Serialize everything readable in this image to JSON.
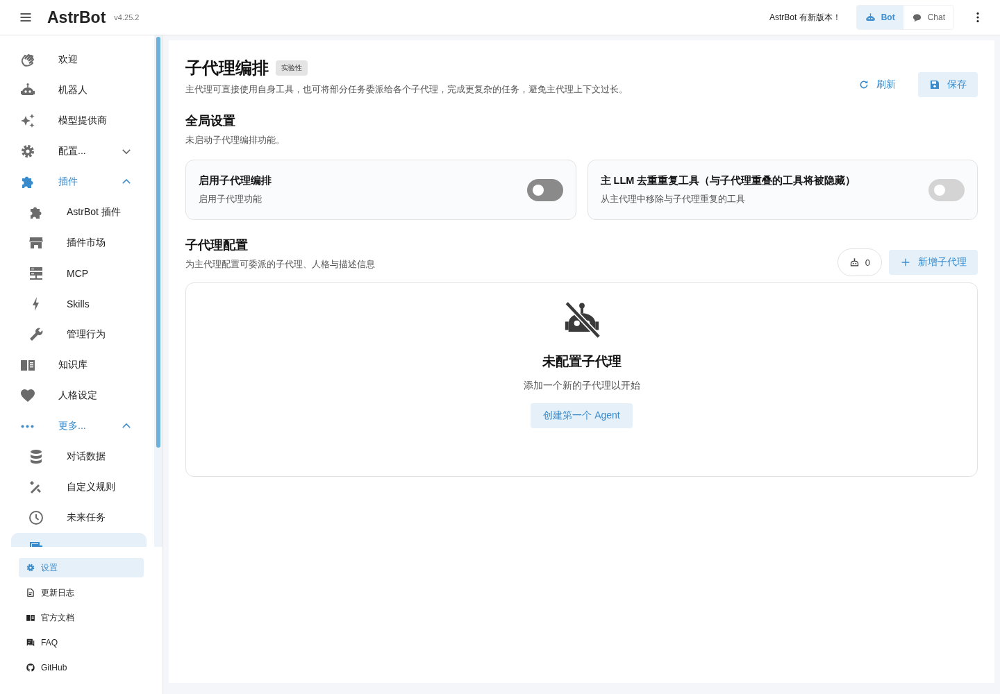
{
  "header": {
    "logo": "AstrBot",
    "version": "v4.25.2",
    "update_notice": "AstrBot 有新版本！",
    "mode_toggle": [
      {
        "label": "Bot",
        "selected": true
      },
      {
        "label": "Chat",
        "selected": false
      }
    ]
  },
  "sidebar": {
    "items": [
      {
        "label": "欢迎",
        "selected": false
      },
      {
        "label": "机器人",
        "selected": false
      },
      {
        "label": "模型提供商",
        "selected": false
      },
      {
        "label": "配置...",
        "selected": false,
        "expanded": false
      },
      {
        "label": "插件",
        "selected": false,
        "expanded": true,
        "children": [
          {
            "label": "AstrBot 插件",
            "selected": false
          },
          {
            "label": "插件市场",
            "selected": false
          },
          {
            "label": "MCP",
            "selected": false
          },
          {
            "label": "Skills",
            "selected": false
          },
          {
            "label": "管理行为",
            "selected": false
          }
        ]
      },
      {
        "label": "知识库",
        "selected": false
      },
      {
        "label": "人格设定",
        "selected": false
      },
      {
        "label": "更多...",
        "selected": false,
        "expanded": true,
        "children": [
          {
            "label": "对话数据",
            "selected": false
          },
          {
            "label": "自定义规则",
            "selected": false
          },
          {
            "label": "未来任务",
            "selected": false
          },
          {
            "selected": true
          }
        ]
      }
    ],
    "footer_items": [
      {
        "label": "设置",
        "selected": true
      },
      {
        "label": "更新日志",
        "selected": false
      },
      {
        "label": "官方文档",
        "selected": false
      },
      {
        "label": "FAQ",
        "selected": false
      },
      {
        "label": "GitHub",
        "selected": false
      }
    ]
  },
  "page": {
    "title": "子代理编排",
    "badge": "实验性",
    "description": "主代理可直接使用自身工具，也可将部分任务委派给各个子代理，完成更复杂的任务，避免主代理上下文过长。",
    "actions": {
      "refresh": "刷新",
      "save": "保存"
    }
  },
  "global_settings": {
    "heading": "全局设置",
    "note": "未启动子代理编排功能。",
    "toggles": [
      {
        "title": "启用子代理编排",
        "subtitle": "启用子代理功能",
        "on": false,
        "disabled": false
      },
      {
        "title": "主 LLM 去重重复工具（与子代理重叠的工具将被隐藏）",
        "subtitle": "从主代理中移除与子代理重复的工具",
        "on": false,
        "disabled": true
      }
    ]
  },
  "subagents": {
    "heading": "子代理配置",
    "description": "为主代理配置可委派的子代理、人格与描述信息",
    "count": "0",
    "add_button": "新增子代理",
    "empty_state": {
      "title": "未配置子代理",
      "text": "添加一个新的子代理以开始",
      "button": "创建第一个 Agent"
    }
  }
}
